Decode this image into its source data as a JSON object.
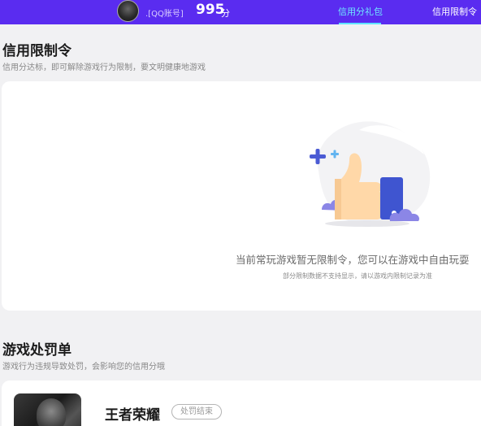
{
  "header": {
    "account_label": ".[QQ账号]",
    "score_value": "995",
    "score_unit": "分",
    "tabs": [
      {
        "label": "信用分礼包",
        "active": true
      },
      {
        "label": "信用限制令",
        "active": false
      }
    ]
  },
  "restriction": {
    "title": "信用限制令",
    "subtitle": "信用分达标，即可解除游戏行为限制，要文明健康地游戏",
    "empty_message": "当前常玩游戏暂无限制令，您可以在游戏中自由玩耍",
    "empty_note": "部分限制数据不支持显示，请以游戏内限制记录为准",
    "illustration": "thumbs-up-illustration"
  },
  "penalty": {
    "title": "游戏处罚单",
    "subtitle": "游戏行为违规导致处罚，会影响您的信用分哦",
    "items": [
      {
        "game": "王者荣耀",
        "status": "处罚结束"
      }
    ]
  },
  "colors": {
    "header_bg": "#5a2cf0",
    "active_tab": "#6fe8ff"
  }
}
